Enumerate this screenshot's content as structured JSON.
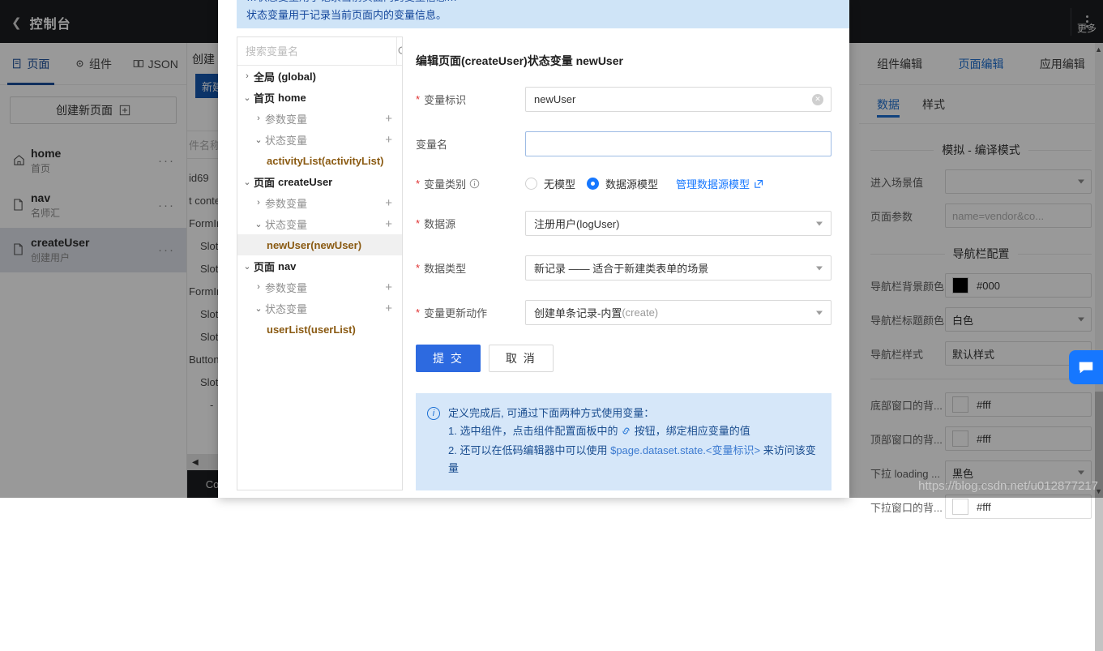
{
  "topbar": {
    "back_icon": "chevron-left-icon",
    "title": "控制台",
    "more_label": "更多",
    "kebab_icon": "kebab-menu-icon"
  },
  "left_panel": {
    "tabs": [
      {
        "label": "页面",
        "icon": "page-icon",
        "active": true
      },
      {
        "label": "组件",
        "icon": "component-icon",
        "active": false
      },
      {
        "label": "JSON",
        "icon": "json-icon",
        "active": false
      }
    ],
    "new_page_button": "创建新页面",
    "new_page_icon": "plus-square-icon",
    "pages": [
      {
        "name": "home",
        "sub": "首页",
        "icon": "home-icon",
        "selected": false,
        "menu": "···"
      },
      {
        "name": "nav",
        "sub": "名师汇",
        "icon": "file-icon",
        "selected": false,
        "menu": "···"
      },
      {
        "name": "createUser",
        "sub": "创建用户",
        "icon": "file-icon",
        "selected": true,
        "menu": "···"
      }
    ]
  },
  "mid_column": {
    "heading": "创建",
    "blue_button": "新建",
    "search_placeholder": "件名称",
    "tree": [
      "id69",
      "t conte",
      "FormIn",
      "Slot",
      "Slot",
      "FormIn",
      "Slot",
      "Slot",
      "Button",
      "Slot",
      "-"
    ],
    "collapse_icon": "collapse-left-icon",
    "console_label": "Co"
  },
  "right_panel": {
    "tabs": [
      {
        "label": "组件编辑",
        "active": false
      },
      {
        "label": "页面编辑",
        "active": true
      },
      {
        "label": "应用编辑",
        "active": false
      }
    ],
    "subtabs": [
      {
        "label": "数据",
        "active": true
      },
      {
        "label": "样式",
        "active": false
      }
    ],
    "sections": [
      {
        "title": "模拟 - 编译模式",
        "rows": [
          {
            "label": "进入场景值",
            "value": "",
            "placeholder": "",
            "type": "select"
          },
          {
            "label": "页面参数",
            "value": "",
            "placeholder": "name=vendor&co...",
            "type": "input"
          }
        ]
      },
      {
        "title": "导航栏配置",
        "rows": [
          {
            "label": "导航栏背景颜色",
            "value": "#000",
            "type": "color",
            "swatch": "#000000"
          },
          {
            "label": "导航栏标题颜色",
            "value": "白色",
            "type": "select"
          },
          {
            "label": "导航栏样式",
            "value": "默认样式",
            "type": "select"
          }
        ]
      },
      {
        "title": "",
        "rows": [
          {
            "label": "底部窗口的背...",
            "value": "#fff",
            "type": "color",
            "swatch": "#ffffff"
          },
          {
            "label": "顶部窗口的背...",
            "value": "#fff",
            "type": "color",
            "swatch": "#ffffff"
          },
          {
            "label": "下拉 loading ...",
            "value": "黑色",
            "type": "select"
          },
          {
            "label": "下拉窗口的背...",
            "value": "#fff",
            "type": "color",
            "swatch": "#ffffff"
          }
        ]
      }
    ],
    "chat_icon": "chat-bubble-icon",
    "scrollbar_up": "▲",
    "scrollbar_down": "▼"
  },
  "watermark": "https://blog.csdn.net/u012877217",
  "modal": {
    "banner_line1": "…状态变量用于记录当前页面内的变量信息…",
    "banner_line2": "状态变量用于记录当前页面内的变量信息。",
    "tree": {
      "search_placeholder": "搜索变量名",
      "search_icon": "search-icon",
      "nodes": [
        {
          "type": "group",
          "arrow": "›",
          "cn": "全局",
          "en": "(global)",
          "expandable": true
        },
        {
          "type": "group",
          "arrow": "⌄",
          "cn": "首页",
          "en": "home",
          "expandable": true
        },
        {
          "type": "sub",
          "arrow": "›",
          "label": "参数变量",
          "plus": "+"
        },
        {
          "type": "sub",
          "arrow": "⌄",
          "label": "状态变量",
          "plus": "+"
        },
        {
          "type": "leaf",
          "label": "activityList(activityList)",
          "active": false
        },
        {
          "type": "group",
          "arrow": "⌄",
          "cn": "页面",
          "en": "createUser",
          "expandable": true
        },
        {
          "type": "sub",
          "arrow": "›",
          "label": "参数变量",
          "plus": "+"
        },
        {
          "type": "sub",
          "arrow": "⌄",
          "label": "状态变量",
          "plus": "+"
        },
        {
          "type": "leaf",
          "label": "newUser(newUser)",
          "active": true
        },
        {
          "type": "group",
          "arrow": "⌄",
          "cn": "页面",
          "en": "nav",
          "expandable": true
        },
        {
          "type": "sub",
          "arrow": "›",
          "label": "参数变量",
          "plus": "+"
        },
        {
          "type": "sub",
          "arrow": "⌄",
          "label": "状态变量",
          "plus": "+"
        },
        {
          "type": "leaf",
          "label": "userList(userList)",
          "active": false
        }
      ]
    },
    "form": {
      "title": "编辑页面(createUser)状态变量 newUser",
      "field_id_label": "变量标识",
      "field_id_value": "newUser",
      "field_id_clear_icon": "clear-circle-icon",
      "field_name_label": "变量名",
      "field_name_value": "",
      "field_kind_label": "变量类别",
      "field_kind_info_icon": "info-circle-icon",
      "radio_no_model": "无模型",
      "radio_datasource_model": "数据源模型",
      "manage_link": "管理数据源模型",
      "manage_link_icon": "external-link-icon",
      "field_datasource_label": "数据源",
      "field_datasource_value": "注册用户(logUser)",
      "field_datatype_label": "数据类型",
      "field_datatype_value": "新记录 —— 适合于新建类表单的场景",
      "field_action_label": "变量更新动作",
      "field_action_value_main": "创建单条记录-内置",
      "field_action_value_sub": "(create)",
      "submit_button": "提 交",
      "cancel_button": "取 消",
      "tip_icon": "info-circle-icon",
      "tip_title": "定义完成后, 可通过下面两种方式使用变量：",
      "tip_line1_a": "1. 选中组件，点击组件配置面板中的",
      "tip_line1_icon": "link-chain-icon",
      "tip_line1_b": "按钮，绑定相应变量的值",
      "tip_line2_a": "2. 还可以在低码编辑器中可以使用",
      "tip_line2_code": "$page.dataset.state.<变量标识>",
      "tip_line2_b": "来访问该变量"
    }
  },
  "colors": {
    "accent_blue": "#1677ff",
    "primary_button": "#2d6ae0",
    "banner_bg": "#cfe4f7",
    "tip_bg": "#d6e7f9",
    "leaf_text": "#8a5a12",
    "dark_header": "#1b1d21"
  }
}
